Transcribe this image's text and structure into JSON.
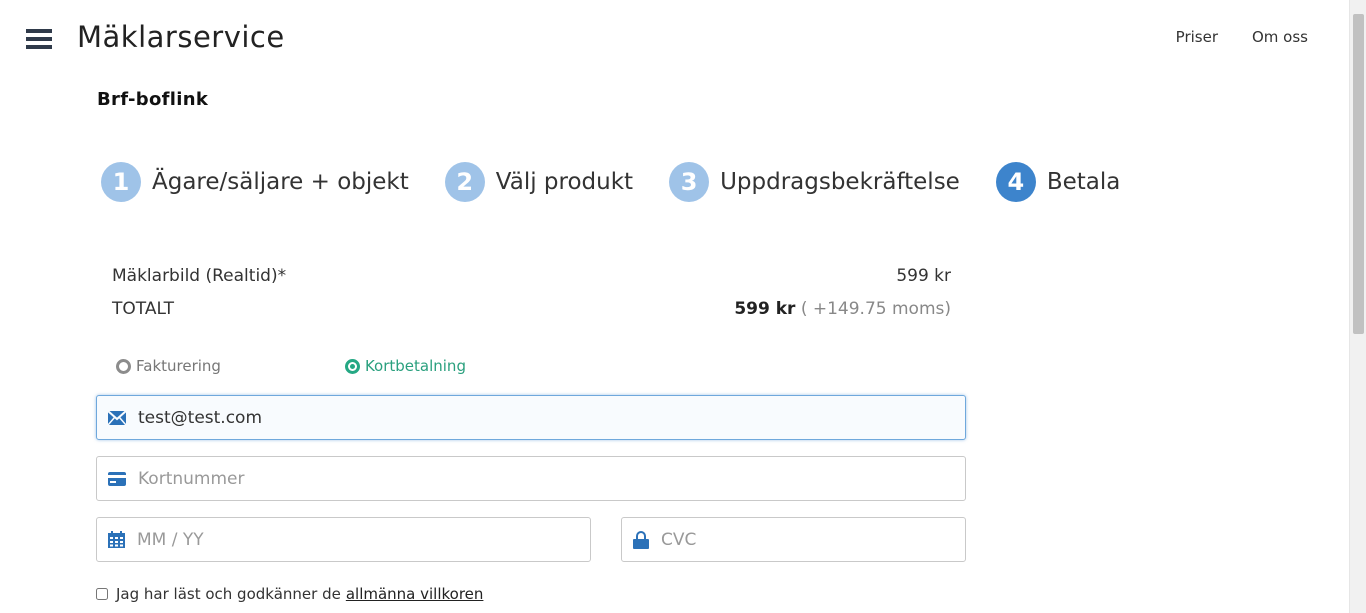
{
  "header": {
    "brand": "Mäklarservice",
    "nav": [
      {
        "label": "Priser"
      },
      {
        "label": "Om oss"
      }
    ]
  },
  "org_name": "Brf-boflink",
  "steps": [
    {
      "num": "1",
      "label": "Ägare/säljare + objekt"
    },
    {
      "num": "2",
      "label": "Välj produkt"
    },
    {
      "num": "3",
      "label": "Uppdragsbekräftelse"
    },
    {
      "num": "4",
      "label": "Betala"
    }
  ],
  "active_step": 4,
  "summary": {
    "item": {
      "label": "Mäklarbild (Realtid)*",
      "price": "599 kr"
    },
    "total": {
      "label": "TOTALT",
      "price": "599 kr",
      "vat": "( +149.75 moms)"
    }
  },
  "payment_methods": {
    "invoice": "Fakturering",
    "card": "Kortbetalning",
    "selected": "card"
  },
  "form": {
    "email": {
      "value": "test@test.com"
    },
    "card_number": {
      "placeholder": "Kortnummer"
    },
    "expiry": {
      "placeholder": "MM / YY"
    },
    "cvc": {
      "placeholder": "CVC"
    }
  },
  "terms": {
    "text": "Jag har läst och godkänner de",
    "link": "allmänna villkoren"
  },
  "colors": {
    "accent": "#3d84cc",
    "step_inactive": "#9fc3e8",
    "selected_green": "#25a884",
    "icon_blue": "#2b71b8"
  }
}
